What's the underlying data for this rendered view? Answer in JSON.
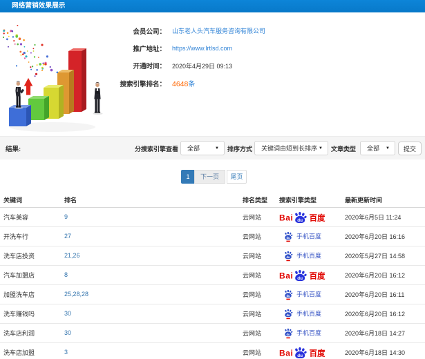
{
  "page": {
    "title": "网络营销效果展示"
  },
  "colors": {
    "titlebar_bg": "#0b80d1",
    "link_blue": "#2e82d6",
    "count_orange": "#ff6600",
    "pagination_active": "#337ab7",
    "baidu_red": "#e10601",
    "baidu_blue": "#2832dc",
    "mobile_baidu_blue": "#3c59c6"
  },
  "info": {
    "rows": [
      {
        "label": "会员公司：",
        "value": "山东老人头汽车服务咨询有限公司",
        "type": "link"
      },
      {
        "label": "推广地址：",
        "value": "https://www.lrtlsd.com",
        "type": "link"
      },
      {
        "label": "开通时间：",
        "value": "2020年4月29日 09:13",
        "type": "text"
      },
      {
        "label": "搜索引擎排名：",
        "value": "4648",
        "unit": "条",
        "type": "count"
      }
    ]
  },
  "filters": {
    "result_label": "结果:",
    "engine_label": "分搜索引擎查看",
    "engine_value": "全部",
    "sort_label": "排序方式",
    "sort_value": "关键词由短到长排序",
    "article_label": "文章类型",
    "article_value": "全部",
    "submit_label": "提交"
  },
  "pagination": {
    "current": "1",
    "next": "下一页",
    "last": "尾页"
  },
  "table": {
    "headers": [
      "关键词",
      "排名",
      "排名类型",
      "搜索引擎类型",
      "最新更新时间"
    ],
    "rows": [
      {
        "keyword": "汽车美容",
        "rank": "9",
        "rank_type": "云网站",
        "engine": "baidu_pc",
        "updated": "2020年6月5日 11:24"
      },
      {
        "keyword": "开洗车行",
        "rank": "27",
        "rank_type": "云网站",
        "engine": "baidu_mobile",
        "updated": "2020年6月20日 16:16"
      },
      {
        "keyword": "洗车店投资",
        "rank": "21,26",
        "rank_type": "云网站",
        "engine": "baidu_mobile",
        "updated": "2020年5月27日 14:58"
      },
      {
        "keyword": "汽车加盟店",
        "rank": "8",
        "rank_type": "云网站",
        "engine": "baidu_pc",
        "updated": "2020年6月20日 16:12"
      },
      {
        "keyword": "加盟洗车店",
        "rank": "25,28,28",
        "rank_type": "云网站",
        "engine": "baidu_mobile",
        "updated": "2020年6月20日 16:11"
      },
      {
        "keyword": "洗车赚钱吗",
        "rank": "30",
        "rank_type": "云网站",
        "engine": "baidu_mobile",
        "updated": "2020年6月20日 16:12"
      },
      {
        "keyword": "洗车店利润",
        "rank": "30",
        "rank_type": "云网站",
        "engine": "baidu_mobile",
        "updated": "2020年6月18日 14:27"
      },
      {
        "keyword": "洗车店加盟",
        "rank": "3",
        "rank_type": "云网站",
        "engine": "baidu_pc",
        "updated": "2020年6月18日 14:30"
      }
    ]
  },
  "engines": {
    "baidu_pc": {
      "bai": "Bai",
      "du": "du",
      "cn": "百度"
    },
    "baidu_mobile": {
      "du": "du",
      "label": "手机百度"
    }
  }
}
